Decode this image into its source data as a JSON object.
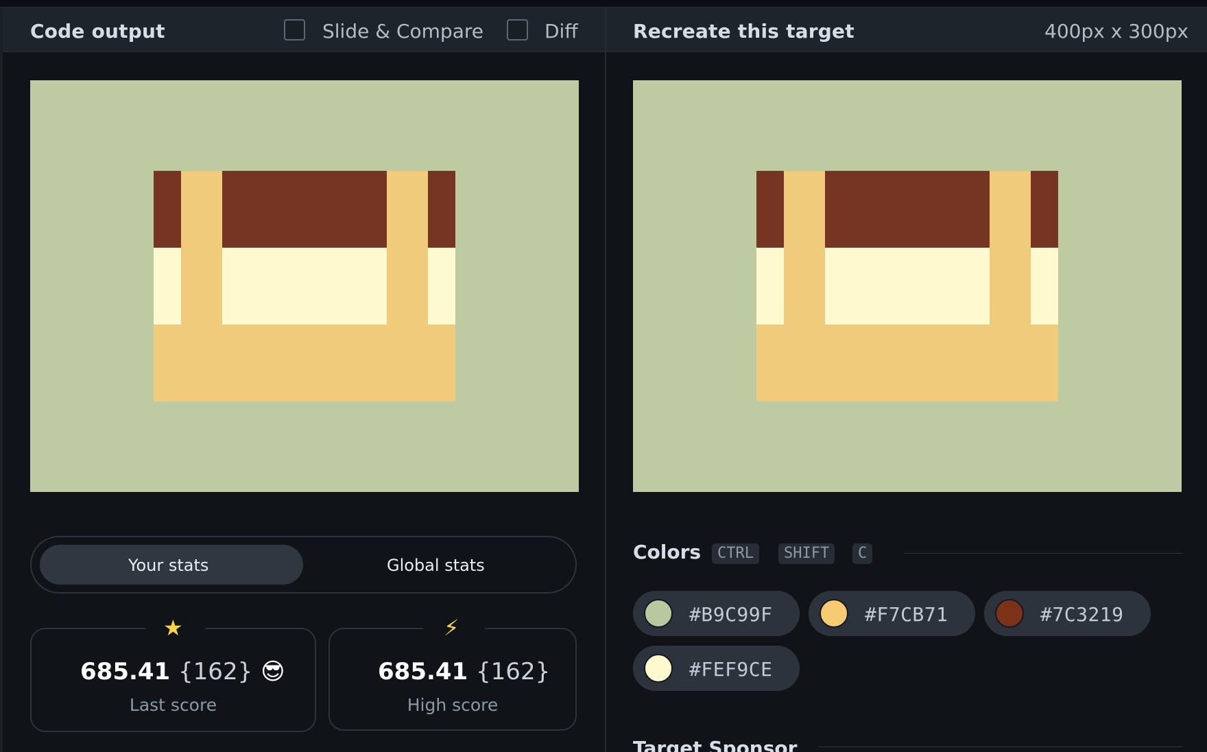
{
  "left": {
    "title": "Code output",
    "slide_compare_label": "Slide & Compare",
    "diff_label": "Diff"
  },
  "right": {
    "title": "Recreate this target",
    "dimensions": "400px x 300px"
  },
  "colors_palette": {
    "background": "#BDCAA2",
    "brown": "#763522",
    "cream": "#FFF9D0",
    "tan": "#F0CB7C"
  },
  "stats": {
    "tab_your": "Your stats",
    "tab_global": "Global stats",
    "last": {
      "icon": "star-icon",
      "glyph": "★",
      "value": "685.41",
      "paren": "{162}",
      "emoji": "😎",
      "label": "Last score"
    },
    "high": {
      "icon": "lightning-icon",
      "glyph": "⚡",
      "value": "685.41",
      "paren": "{162}",
      "label": "High score"
    }
  },
  "colors": {
    "title": "Colors",
    "shortcut": [
      "CTRL",
      "SHIFT",
      "C"
    ],
    "swatches": [
      {
        "hex": "#B9C99F",
        "color": "#B9C99F"
      },
      {
        "hex": "#F7CB71",
        "color": "#F7CB71"
      },
      {
        "hex": "#7C3219",
        "color": "#7C3219"
      },
      {
        "hex": "#FEF9CE",
        "color": "#FEF9CE"
      }
    ]
  },
  "sponsor": {
    "title": "Target Sponsor"
  }
}
